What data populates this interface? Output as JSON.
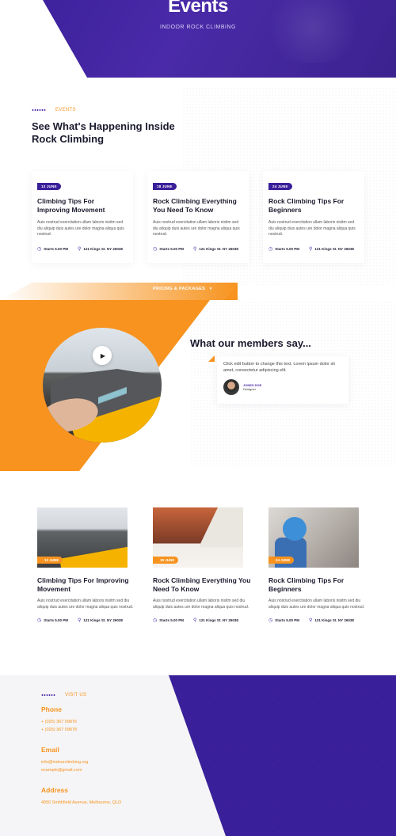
{
  "hero": {
    "title": "Events",
    "subtitle": "INDOOR ROCK CLIMBING"
  },
  "events_section": {
    "eyebrow": "EVENTS",
    "title": "See What's Happening Inside Rock Climbing",
    "cards": [
      {
        "date": "12 JUNE",
        "title": "Climbing Tips For Improving Movement",
        "text": "Auis nostrud exercitation ullam laboris nisitm sed diu aliquip duis autes ure dolor magna aliqua quis nostrud.",
        "time": "Starts 5.00 PM",
        "location": "121 Kings St. NY 26038"
      },
      {
        "date": "18 JUNE",
        "title": "Rock Climbing Everything You Need To Know",
        "text": "Auis nostrud exercitation ullam laboris nisitm sed diu aliquip duis autes ure dolor magna aliqua quis nostrud.",
        "time": "Starts 5.00 PM",
        "location": "121 Kings St. NY 26038"
      },
      {
        "date": "24 JUNE",
        "title": "Rock Climbing Tips For Beginners",
        "text": "Auis nostrud exercitation ullam laboris nisitm sed diu aliquip duis autes ure dolor magna aliqua quis nostrud.",
        "time": "Starts 5.00 PM",
        "location": "121 Kings St. NY 26038"
      }
    ]
  },
  "pricing_link": "PRICING & PACKAGES",
  "testimonial": {
    "title": "What our members say...",
    "quote": "Click edit button to change this text. Lorem ipsum dolor sit amet, consectetur adipiscing elit.",
    "name": "JONES DOE",
    "role": "Designer"
  },
  "events_grid": [
    {
      "date": "12 JUNE",
      "title": "Climbing Tips For Improving Movement",
      "text": "Auis nostrud exercitation ullam laboris nisitm sed diu aliquip duis autes ure dolor magna aliqua quis nostrud.",
      "time": "Starts 5.00 PM",
      "location": "121 Kings St. NY 26038"
    },
    {
      "date": "18 JUNE",
      "title": "Rock Climbing Everything You Need To Know",
      "text": "Auis nostrud exercitation ullam laboris nisitm sed diu aliquip duis autes ure dolor magna aliqua quis nostrud.",
      "time": "Starts 5.00 PM",
      "location": "121 Kings St. NY 26038"
    },
    {
      "date": "24 JUNE",
      "title": "Rock Climbing Tips For Beginners",
      "text": "Auis nostrud exercitation ullam laboris nisitm sed diu aliquip duis autes ure dolor magna aliqua quis nostrud.",
      "time": "Starts 5.00 PM",
      "location": "121 Kings St. NY 26038"
    }
  ],
  "footer": {
    "eyebrow": "VISIT US",
    "phone_heading": "Phone",
    "phones": [
      "+ (025) 367 09876",
      "+ (025) 367 09878"
    ],
    "email_heading": "Email",
    "emails": [
      "info@indoorclimbing.org",
      "example@gmail.com"
    ],
    "address_heading": "Address",
    "address": "4050 Smithfield Avenue, Melbourne, QLD"
  },
  "colors": {
    "brand_purple": "#3a1f9a",
    "accent_orange": "#f7931e"
  },
  "icons": {
    "play": "play-icon",
    "clock": "clock-icon",
    "pin": "location-pin-icon",
    "chevron": "chevron-down-icon"
  }
}
